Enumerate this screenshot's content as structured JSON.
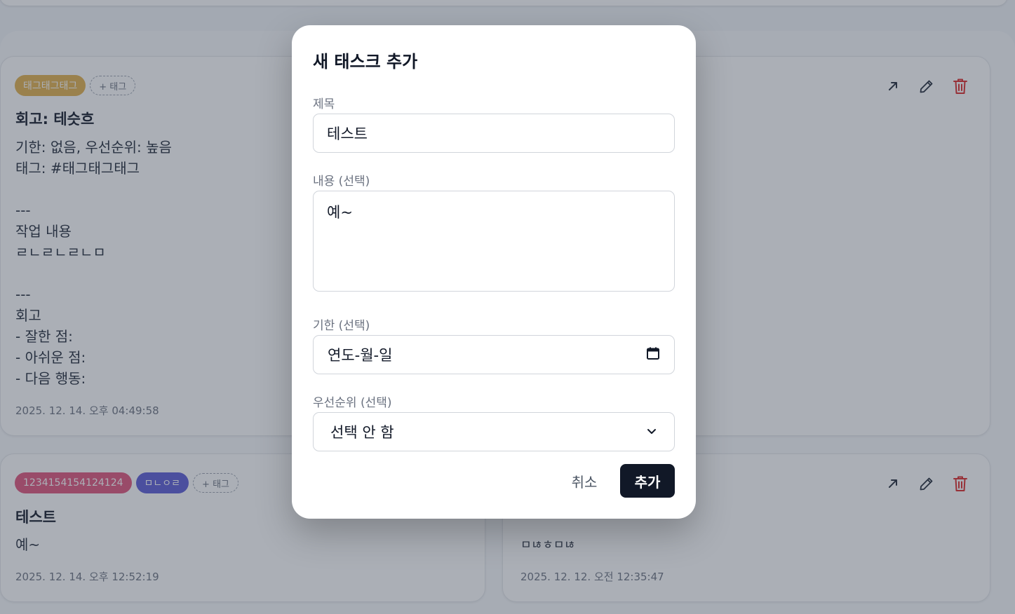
{
  "cards": [
    {
      "tags": [
        {
          "label": "태그태그태그",
          "color": "#e2b04a"
        }
      ],
      "add_tag_label": "+ 태그",
      "title": "회고: 테슷흐",
      "body": "기한: 없음, 우선순위: 높음\n태그: #태그태그태그\n\n---\n작업 내용\nㄹㄴㄹㄴㄹㄴㅁ\n\n---\n회고\n- 잘한 점:\n- 아쉬운 점:\n- 다음 행동:",
      "timestamp": "2025. 12. 14. 오후 04:49:58"
    },
    {
      "tags": [
        {
          "label": "1234154154124124",
          "color": "#e0537a"
        },
        {
          "label": "ㅁㄴㅇㄹ",
          "color": "#5b5bd6"
        }
      ],
      "add_tag_label": "+ 태그",
      "title": "테스트",
      "body": "예~",
      "timestamp": "2025. 12. 14. 오후 12:52:19"
    },
    {
      "body": "ㅁㄶㅎㅁㄶ",
      "timestamp": "2025. 12. 12. 오전 12:35:47"
    }
  ],
  "icons": {
    "open": "arrow-up-right-icon",
    "edit": "pencil-icon",
    "delete": "trash-icon"
  },
  "colors": {
    "delete": "#dc2626",
    "primary_button": "#111827"
  },
  "modal": {
    "title": "새 태스크 추가",
    "title_label": "제목",
    "title_value": "테스트",
    "content_label": "내용 (선택)",
    "content_value": "예~",
    "due_label": "기한 (선택)",
    "due_placeholder": "연도-월-일",
    "priority_label": "우선순위 (선택)",
    "priority_value": "선택 안 함",
    "cancel_label": "취소",
    "submit_label": "추가"
  }
}
